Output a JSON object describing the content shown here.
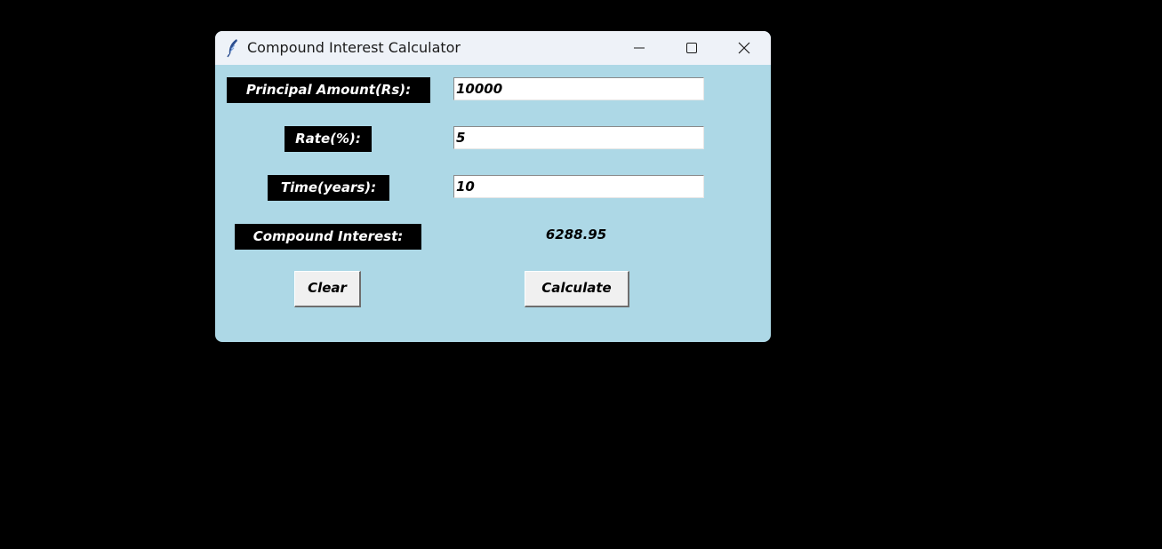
{
  "window": {
    "title": "Compound Interest Calculator",
    "icons": {
      "app": "feather-icon",
      "minimize": "minimize-icon",
      "maximize": "maximize-icon",
      "close": "close-icon"
    }
  },
  "form": {
    "principal_label": "Principal Amount(Rs):",
    "principal_value": "10000",
    "rate_label": "Rate(%):",
    "rate_value": "5",
    "time_label": "Time(years):",
    "time_value": "10",
    "ci_label": "Compound Interest:",
    "ci_value": "6288.95"
  },
  "buttons": {
    "clear_label": "Clear",
    "calculate_label": "Calculate"
  },
  "colors": {
    "desktop": "#000000",
    "window_bg": "#add8e6",
    "titlebar_bg": "#eef2f8",
    "label_bg": "#000000",
    "label_text": "#ffffff"
  }
}
